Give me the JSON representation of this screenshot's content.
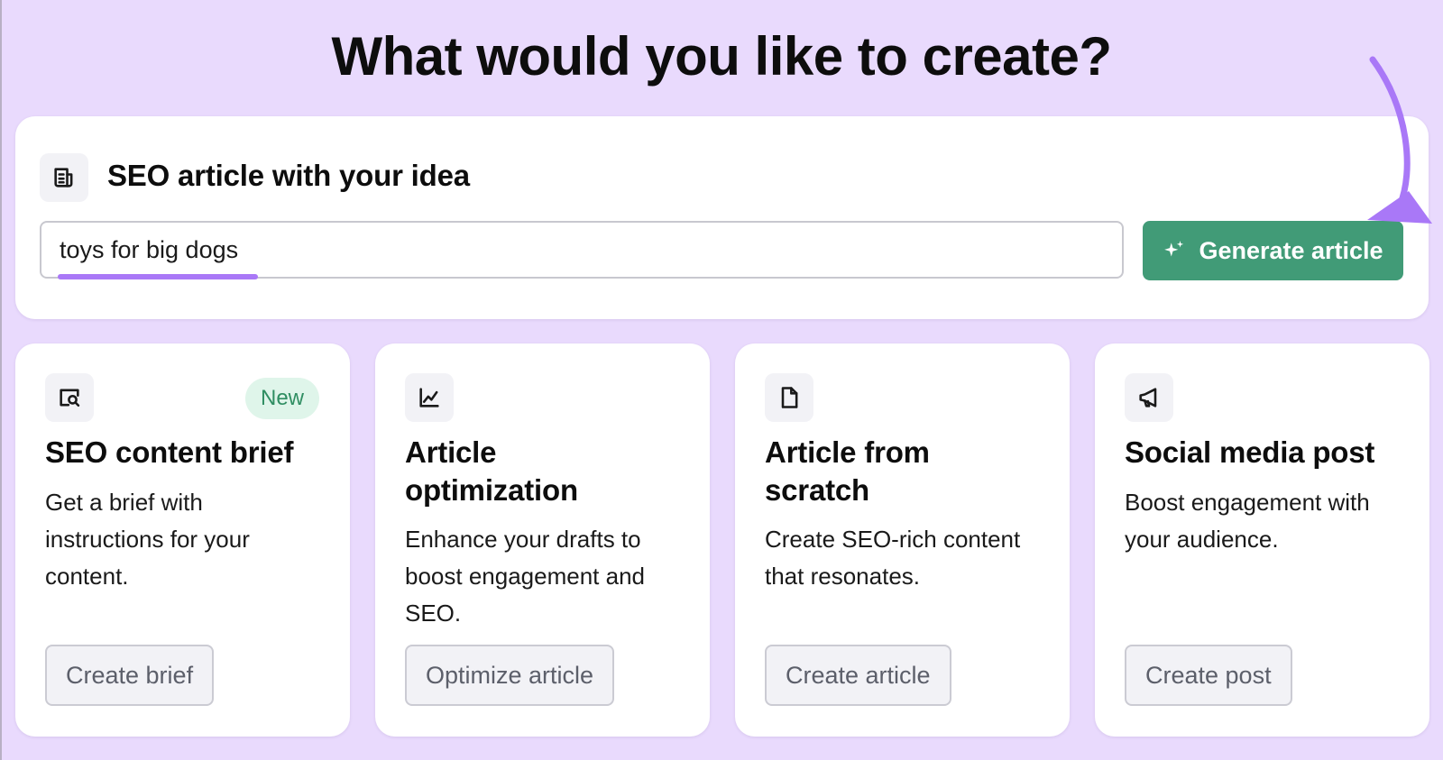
{
  "page": {
    "heading": "What would you like to create?"
  },
  "seo_article": {
    "title": "SEO article with your idea",
    "icon": "article-icon",
    "input_value": "toys for big dogs",
    "button_label": "Generate article",
    "button_icon": "sparkle-icon"
  },
  "cards": [
    {
      "icon": "search-document-icon",
      "badge": "New",
      "title": "SEO content brief",
      "description": "Get a brief with instructions for your content.",
      "button_label": "Create brief"
    },
    {
      "icon": "chart-line-icon",
      "title": "Article optimization",
      "description": "Enhance your drafts to boost engagement and SEO.",
      "button_label": "Optimize article"
    },
    {
      "icon": "document-icon",
      "title": "Article from scratch",
      "description": "Create SEO-rich content that resonates.",
      "button_label": "Create article"
    },
    {
      "icon": "megaphone-icon",
      "title": "Social media post",
      "description": "Boost engagement with your audience.",
      "button_label": "Create post"
    }
  ],
  "colors": {
    "background": "#e9dafd",
    "primary_button": "#419b77",
    "annotation": "#a978f7",
    "badge_bg": "#dff5ea",
    "badge_text": "#2f8e62"
  }
}
